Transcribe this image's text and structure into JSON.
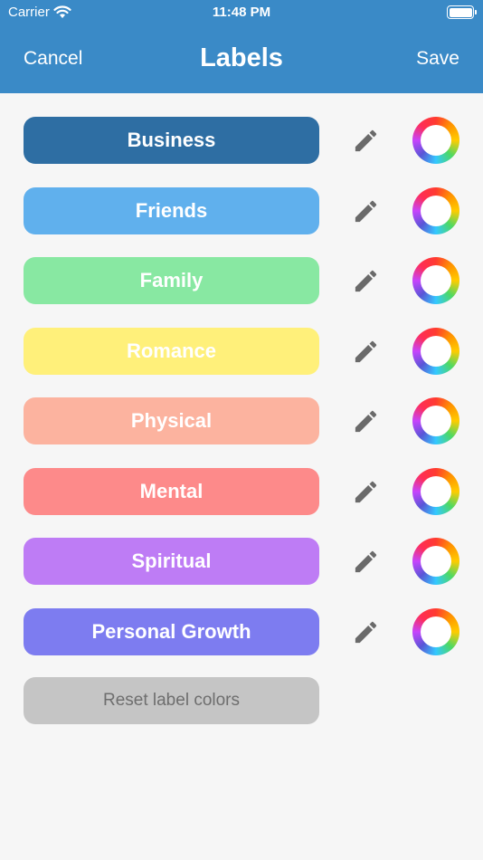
{
  "status_bar": {
    "carrier": "Carrier",
    "time": "11:48 PM"
  },
  "nav": {
    "cancel": "Cancel",
    "title": "Labels",
    "save": "Save"
  },
  "labels": [
    {
      "name": "Business",
      "color": "#2e6ea3"
    },
    {
      "name": "Friends",
      "color": "#60b0ed"
    },
    {
      "name": "Family",
      "color": "#88e8a2"
    },
    {
      "name": "Romance",
      "color": "#fff07a"
    },
    {
      "name": "Physical",
      "color": "#fcb39f"
    },
    {
      "name": "Mental",
      "color": "#fd8a8a"
    },
    {
      "name": "Spiritual",
      "color": "#be7cf5"
    },
    {
      "name": "Personal Growth",
      "color": "#7d7cf0"
    }
  ],
  "reset_label": "Reset label colors",
  "colors": {
    "header": "#3a8ac7",
    "background": "#f6f6f6",
    "reset_bg": "#c5c5c5",
    "icon": "#6a6a6a"
  },
  "icons": {
    "wifi": "wifi-icon",
    "battery": "battery-icon",
    "edit": "pencil-icon",
    "color_picker": "color-wheel-icon"
  }
}
